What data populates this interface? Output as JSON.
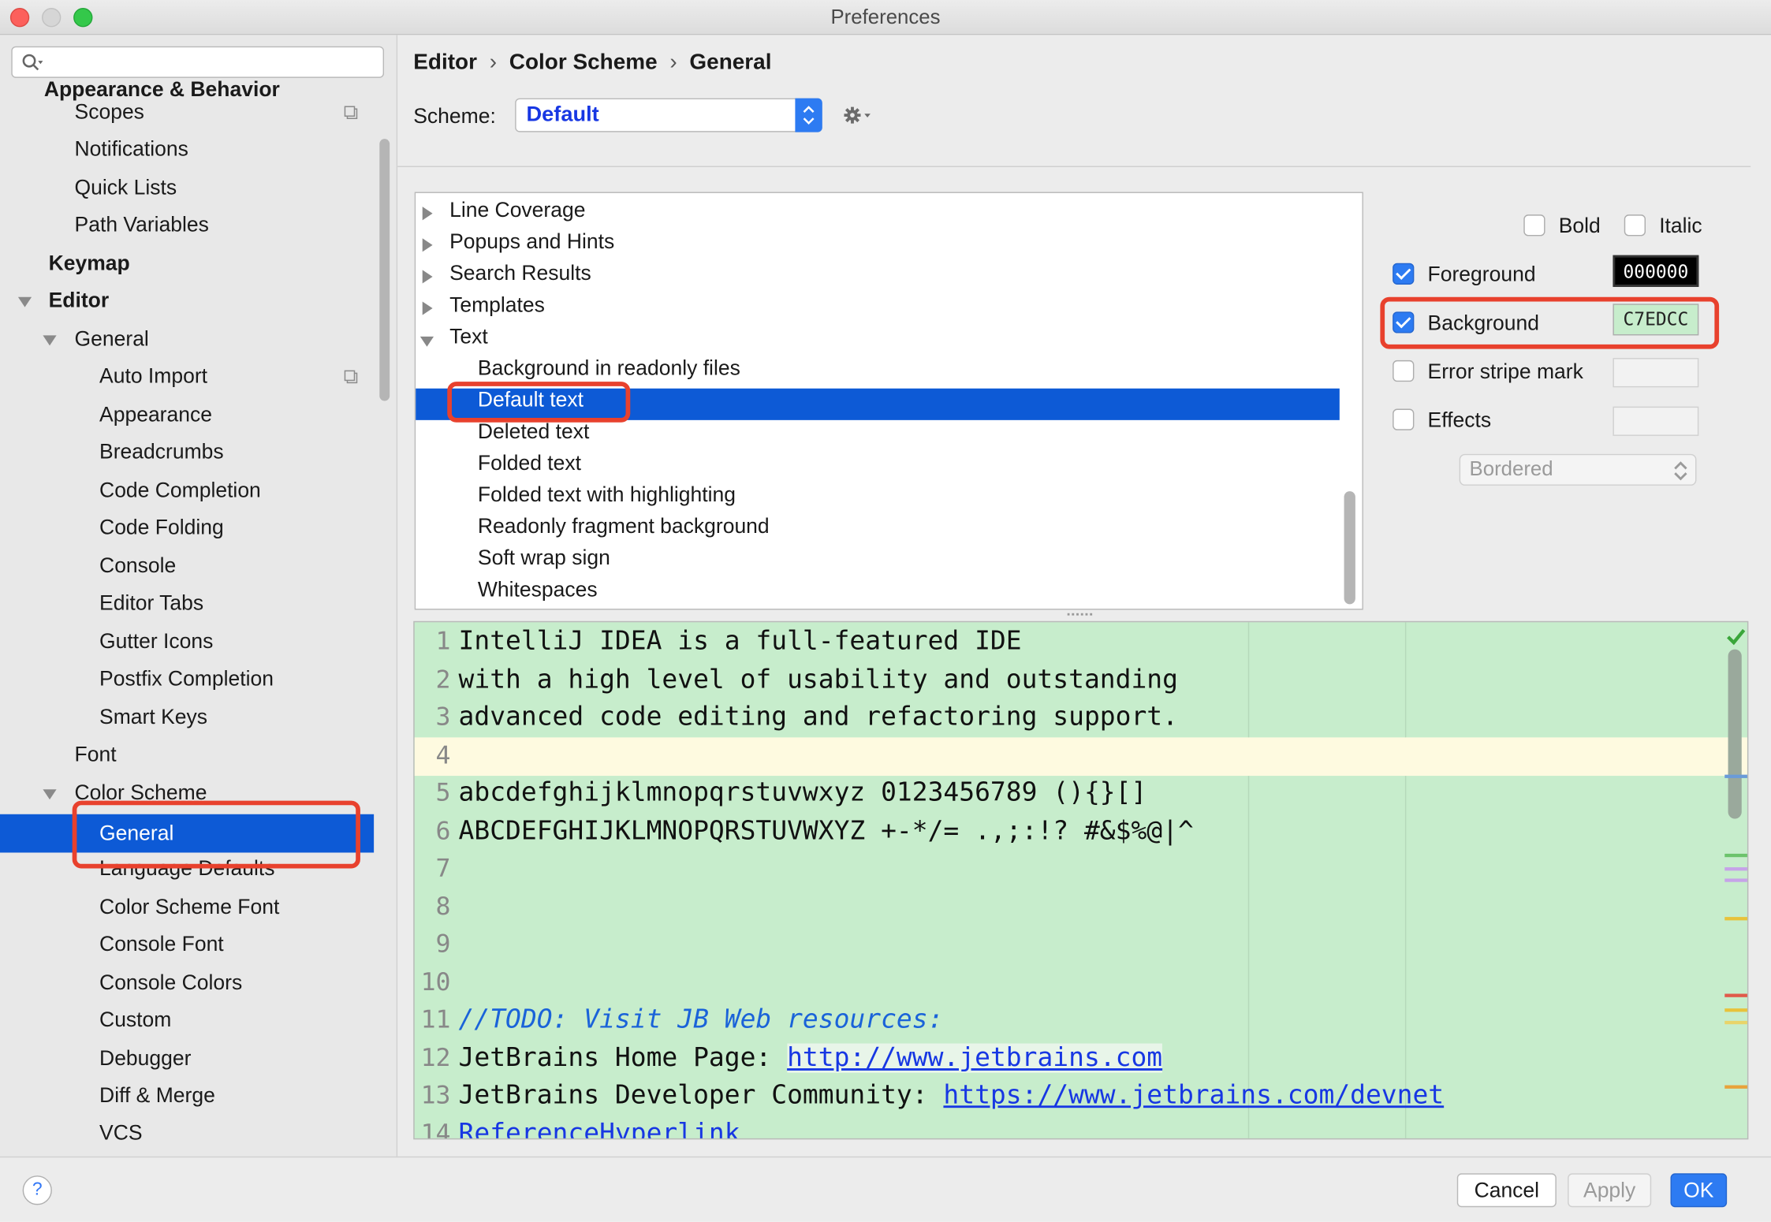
{
  "window": {
    "title": "Preferences"
  },
  "sidebar": {
    "search_placeholder": "",
    "items": [
      {
        "label": "Appearance & Behavior",
        "bold": true
      },
      {
        "label": "Scopes"
      },
      {
        "label": "Notifications"
      },
      {
        "label": "Quick Lists"
      },
      {
        "label": "Path Variables"
      },
      {
        "label": "Keymap",
        "bold": true
      },
      {
        "label": "Editor",
        "bold": true,
        "expanded": true
      },
      {
        "label": "General",
        "expanded": true
      },
      {
        "label": "Auto Import"
      },
      {
        "label": "Appearance"
      },
      {
        "label": "Breadcrumbs"
      },
      {
        "label": "Code Completion"
      },
      {
        "label": "Code Folding"
      },
      {
        "label": "Console"
      },
      {
        "label": "Editor Tabs"
      },
      {
        "label": "Gutter Icons"
      },
      {
        "label": "Postfix Completion"
      },
      {
        "label": "Smart Keys"
      },
      {
        "label": "Font"
      },
      {
        "label": "Color Scheme",
        "expanded": true
      },
      {
        "label": "General",
        "selected": true
      },
      {
        "label": "Language Defaults"
      },
      {
        "label": "Color Scheme Font"
      },
      {
        "label": "Console Font"
      },
      {
        "label": "Console Colors"
      },
      {
        "label": "Custom"
      },
      {
        "label": "Debugger"
      },
      {
        "label": "Diff & Merge"
      },
      {
        "label": "VCS"
      }
    ]
  },
  "breadcrumb": {
    "items": [
      "Editor",
      "Color Scheme",
      "General"
    ]
  },
  "scheme": {
    "label": "Scheme:",
    "value": "Default"
  },
  "tree": {
    "items": [
      {
        "label": "Line Coverage",
        "collapsed": true
      },
      {
        "label": "Popups and Hints",
        "collapsed": true
      },
      {
        "label": "Search Results",
        "collapsed": true
      },
      {
        "label": "Templates",
        "collapsed": true
      },
      {
        "label": "Text",
        "expanded": true
      },
      {
        "label": "Background in readonly files"
      },
      {
        "label": "Default text",
        "selected": true
      },
      {
        "label": "Deleted text"
      },
      {
        "label": "Folded text"
      },
      {
        "label": "Folded text with highlighting"
      },
      {
        "label": "Readonly fragment background"
      },
      {
        "label": "Soft wrap sign"
      },
      {
        "label": "Whitespaces"
      }
    ]
  },
  "attributes": {
    "bold": {
      "label": "Bold",
      "checked": false
    },
    "italic": {
      "label": "Italic",
      "checked": false
    },
    "foreground": {
      "label": "Foreground",
      "checked": true,
      "value": "000000"
    },
    "background": {
      "label": "Background",
      "checked": true,
      "value": "C7EDCC"
    },
    "error_stripe": {
      "label": "Error stripe mark",
      "checked": false
    },
    "effects": {
      "label": "Effects",
      "checked": false,
      "style": "Bordered"
    }
  },
  "preview": {
    "lines": [
      {
        "n": "1",
        "text": "IntelliJ IDEA is a full-featured IDE"
      },
      {
        "n": "2",
        "text": "with a high level of usability and outstanding"
      },
      {
        "n": "3",
        "text": "advanced code editing and refactoring support."
      },
      {
        "n": "4",
        "text": "",
        "current": true
      },
      {
        "n": "5",
        "text": "abcdefghijklmnopqrstuvwxyz 0123456789 (){}[]"
      },
      {
        "n": "6",
        "text": "ABCDEFGHIJKLMNOPQRSTUVWXYZ +-*/= .,;:!? #&$%@|^"
      },
      {
        "n": "7",
        "text": ""
      },
      {
        "n": "8",
        "text": ""
      },
      {
        "n": "9",
        "text": ""
      },
      {
        "n": "10",
        "text": ""
      },
      {
        "n": "11",
        "comment": "//TODO: Visit JB Web resources:"
      },
      {
        "n": "12",
        "text": "JetBrains Home Page: ",
        "link": "http://www.jetbrains.com"
      },
      {
        "n": "13",
        "text": "JetBrains Developer Community: ",
        "link": "https://www.jetbrains.com/devnet"
      },
      {
        "n": "14",
        "reflink": "ReferenceHyperlink"
      }
    ]
  },
  "colors": {
    "selection": "#0d5ad6",
    "accent": "#2d7bf2",
    "highlight_box": "#e8412d",
    "preview_bg": "#C7EDCC"
  },
  "buttons": {
    "help": "?",
    "cancel": "Cancel",
    "apply": "Apply",
    "ok": "OK"
  }
}
